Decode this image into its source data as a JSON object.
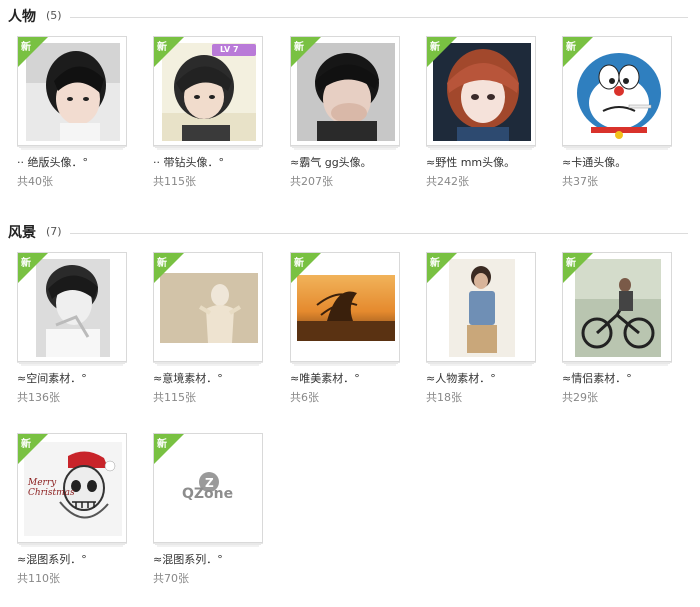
{
  "sections": [
    {
      "title": "人物",
      "count": "(5)",
      "albums": [
        {
          "name": "·· 绝版头像．°",
          "count": "共40张",
          "badge": "新",
          "image": "portrait-girl-short-hair"
        },
        {
          "name": "·· 带钻头像．°",
          "count": "共115张",
          "badge": "新",
          "image": "portrait-bob-hair-lv7"
        },
        {
          "name": "≈霸气 gg头像。",
          "count": "共207张",
          "badge": "新",
          "image": "portrait-hand-over-mouth"
        },
        {
          "name": "≈野性 mm头像。",
          "count": "共242张",
          "badge": "新",
          "image": "portrait-red-hair-girl"
        },
        {
          "name": "≈卡通头像。",
          "count": "共37张",
          "badge": "新",
          "image": "doraemon-cartoon"
        }
      ]
    },
    {
      "title": "风景",
      "count": "(7)",
      "albums": [
        {
          "name": "≈空间素材．°",
          "count": "共136张",
          "badge": "新",
          "image": "portrait-bw-blurred"
        },
        {
          "name": "≈意境素材．°",
          "count": "共115张",
          "badge": "新",
          "image": "sepia-figure"
        },
        {
          "name": "≈唯美素材．°",
          "count": "共6张",
          "badge": "新",
          "image": "hair-flip-sunset"
        },
        {
          "name": "≈人物素材．°",
          "count": "共18张",
          "badge": "新",
          "image": "young-man-standing"
        },
        {
          "name": "≈情侣素材．°",
          "count": "共29张",
          "badge": "新",
          "image": "couple-bicycle"
        },
        {
          "name": "≈混图系列．°",
          "count": "共110张",
          "badge": "新",
          "image": "merry-christmas-skull"
        },
        {
          "name": "≈混图系列．°",
          "count": "共70张",
          "badge": "新",
          "image": "qzone-logo"
        }
      ]
    }
  ],
  "logos": {
    "lv_badge": "LV 7",
    "merry": "Merry Christmas",
    "qzone": "QZone"
  }
}
